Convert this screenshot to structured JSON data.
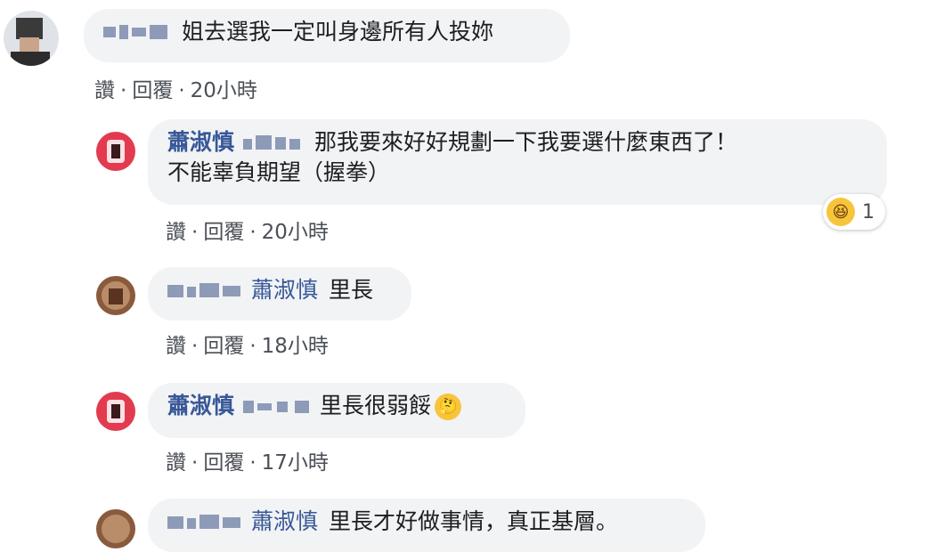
{
  "comments": [
    {
      "author": "",
      "text": "姐去選我一定叫身邊所有人投妳",
      "actions": {
        "like": "讚",
        "reply": "回覆",
        "time": "20小時"
      }
    },
    {
      "author": "蕭淑慎",
      "text_line1": "那我要來好好規劃一下我要選什麼東西了！",
      "text_line2": "不能辜負期望（握拳）",
      "reaction": {
        "icon": "laughing-emoji",
        "count": "1"
      },
      "actions": {
        "like": "讚",
        "reply": "回覆",
        "time": "20小時"
      }
    },
    {
      "tag": "蕭淑慎",
      "text": "里長",
      "actions": {
        "like": "讚",
        "reply": "回覆",
        "time": "18小時"
      }
    },
    {
      "author": "蕭淑慎",
      "text": "里長很弱餒",
      "emoji": "thinking-emoji",
      "actions": {
        "like": "讚",
        "reply": "回覆",
        "time": "17小時"
      }
    },
    {
      "tag": "蕭淑慎",
      "text": "里長才好做事情，真正基層。"
    }
  ],
  "separator": "·",
  "colors": {
    "link": "#385898",
    "bubble": "#f2f3f5",
    "meta": "#4b4f56"
  }
}
